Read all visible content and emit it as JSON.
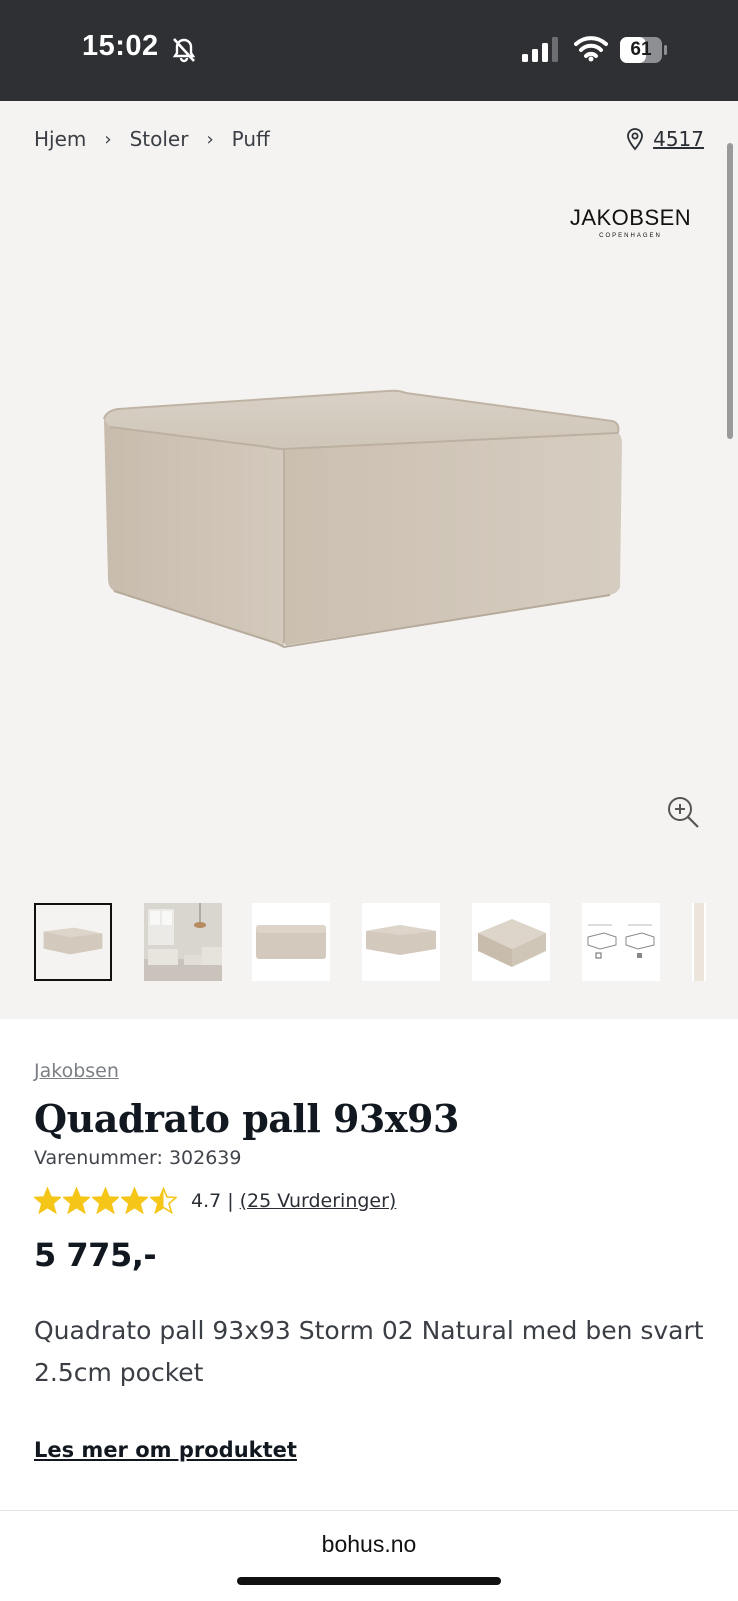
{
  "status_bar": {
    "time": "15:02",
    "battery": "61",
    "icons": [
      "bell-muted-icon",
      "signal-icon",
      "wifi-icon",
      "battery-icon"
    ]
  },
  "breadcrumb": {
    "items": [
      "Hjem",
      "Stoler",
      "Puff"
    ]
  },
  "store": {
    "icon": "location-pin-icon",
    "number": "4517"
  },
  "brand_logo": {
    "main": "JAKOBSEN",
    "sub": "COPENHAGEN"
  },
  "gallery": {
    "thumbnail_count": 7,
    "active_index": 0
  },
  "product": {
    "brand": "Jakobsen",
    "title": "Quadrato pall 93x93",
    "sku": "Varenummer: 302639",
    "rating": {
      "value": "4.7",
      "separator": "|",
      "count_text": "(25 Vurderinger)",
      "stars_filled": 4.5,
      "stars_total": 5,
      "star_color": "#f5c518"
    },
    "price": "5 775,-",
    "description": "Quadrato pall 93x93 Storm 02 Natural med ben svart 2.5cm pocket",
    "read_more": "Les mer om produktet"
  },
  "browser": {
    "url": "bohus.no"
  }
}
